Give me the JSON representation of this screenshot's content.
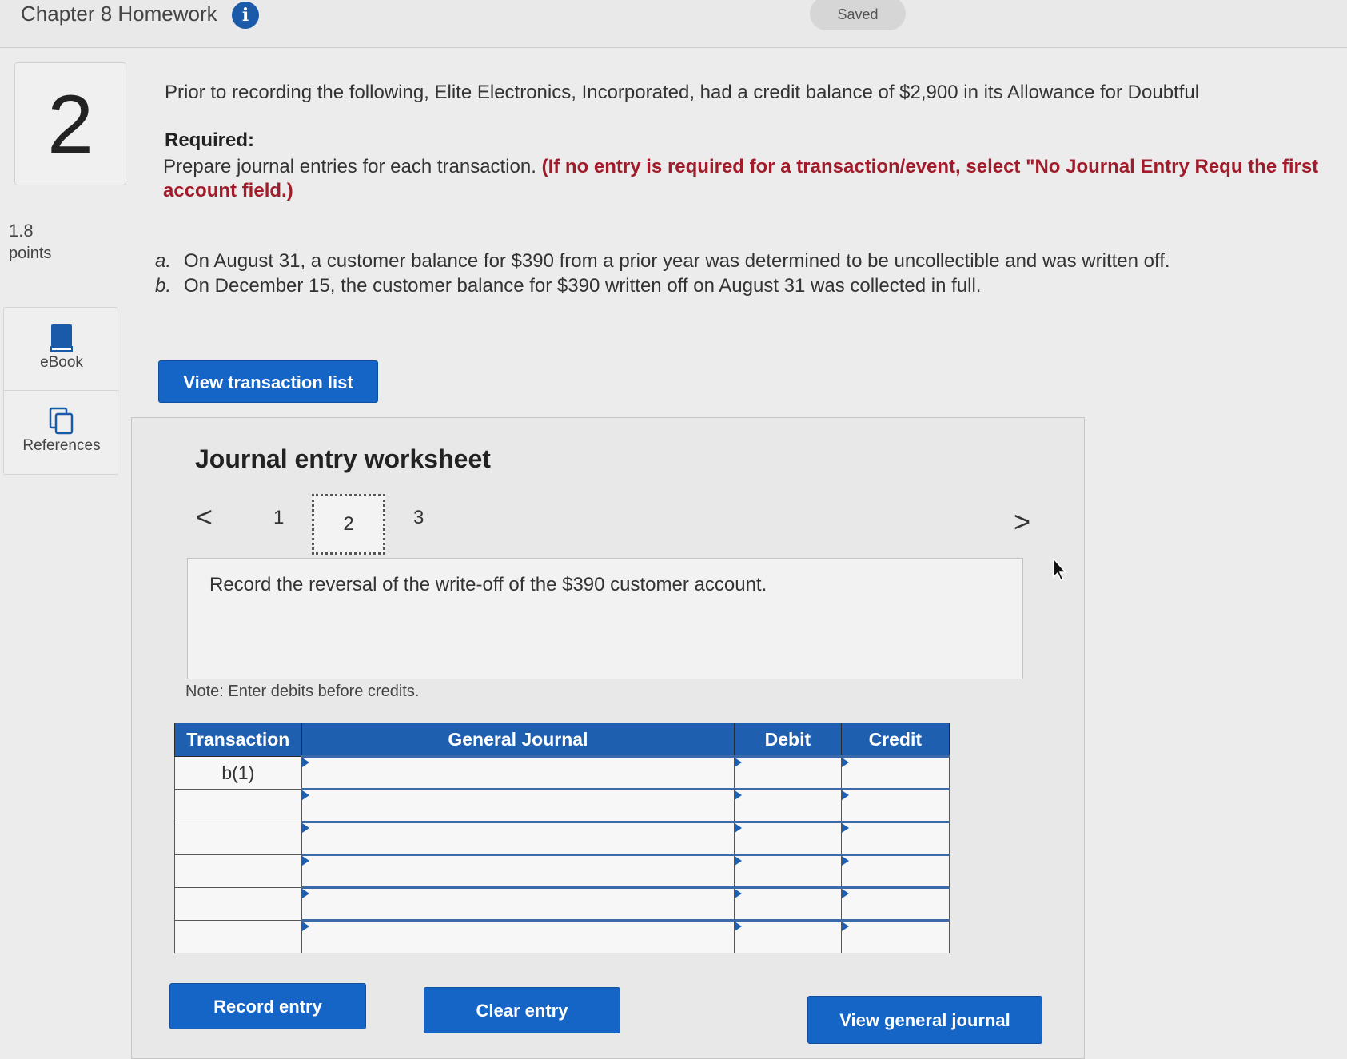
{
  "header": {
    "title": "Chapter 8 Homework",
    "info_icon": "i",
    "status": "Saved"
  },
  "question": {
    "number": "2",
    "points_value": "1.8",
    "points_label": "points"
  },
  "sidebar": {
    "items": [
      {
        "label": "eBook",
        "icon": "book-icon"
      },
      {
        "label": "References",
        "icon": "copy-pages-icon"
      }
    ]
  },
  "problem": {
    "intro": "Prior to recording the following, Elite Electronics, Incorporated, had a credit balance of $2,900 in its Allowance for Doubtful",
    "required_heading": "Required:",
    "required_text": "Prepare journal entries for each transaction.",
    "required_note": "(If no entry is required for a transaction/event, select \"No Journal Entry Requ the first account field.)",
    "items": [
      {
        "marker": "a.",
        "text": "On August 31, a customer balance for $390 from a prior year was determined to be uncollectible and was written off."
      },
      {
        "marker": "b.",
        "text": "On December 15, the customer balance for $390 written off on August 31 was collected in full."
      }
    ]
  },
  "buttons": {
    "view_transaction_list": "View transaction list",
    "record_entry": "Record entry",
    "clear_entry": "Clear entry",
    "view_general_journal": "View general journal"
  },
  "worksheet": {
    "title": "Journal entry worksheet",
    "prev": "<",
    "next": ">",
    "pages": [
      "1",
      "2",
      "3"
    ],
    "current_page": "2",
    "instruction": "Record the reversal of the write-off of the $390 customer account.",
    "note": "Note: Enter debits before credits.",
    "columns": [
      "Transaction",
      "General Journal",
      "Debit",
      "Credit"
    ],
    "rows": [
      {
        "transaction": "b(1)",
        "account": "",
        "debit": "",
        "credit": ""
      },
      {
        "transaction": "",
        "account": "",
        "debit": "",
        "credit": ""
      },
      {
        "transaction": "",
        "account": "",
        "debit": "",
        "credit": ""
      },
      {
        "transaction": "",
        "account": "",
        "debit": "",
        "credit": ""
      },
      {
        "transaction": "",
        "account": "",
        "debit": "",
        "credit": ""
      },
      {
        "transaction": "",
        "account": "",
        "debit": "",
        "credit": ""
      }
    ]
  },
  "colors": {
    "accent": "#1565c6",
    "table_header": "#1f5fb0",
    "required_note": "#a11c2a"
  }
}
